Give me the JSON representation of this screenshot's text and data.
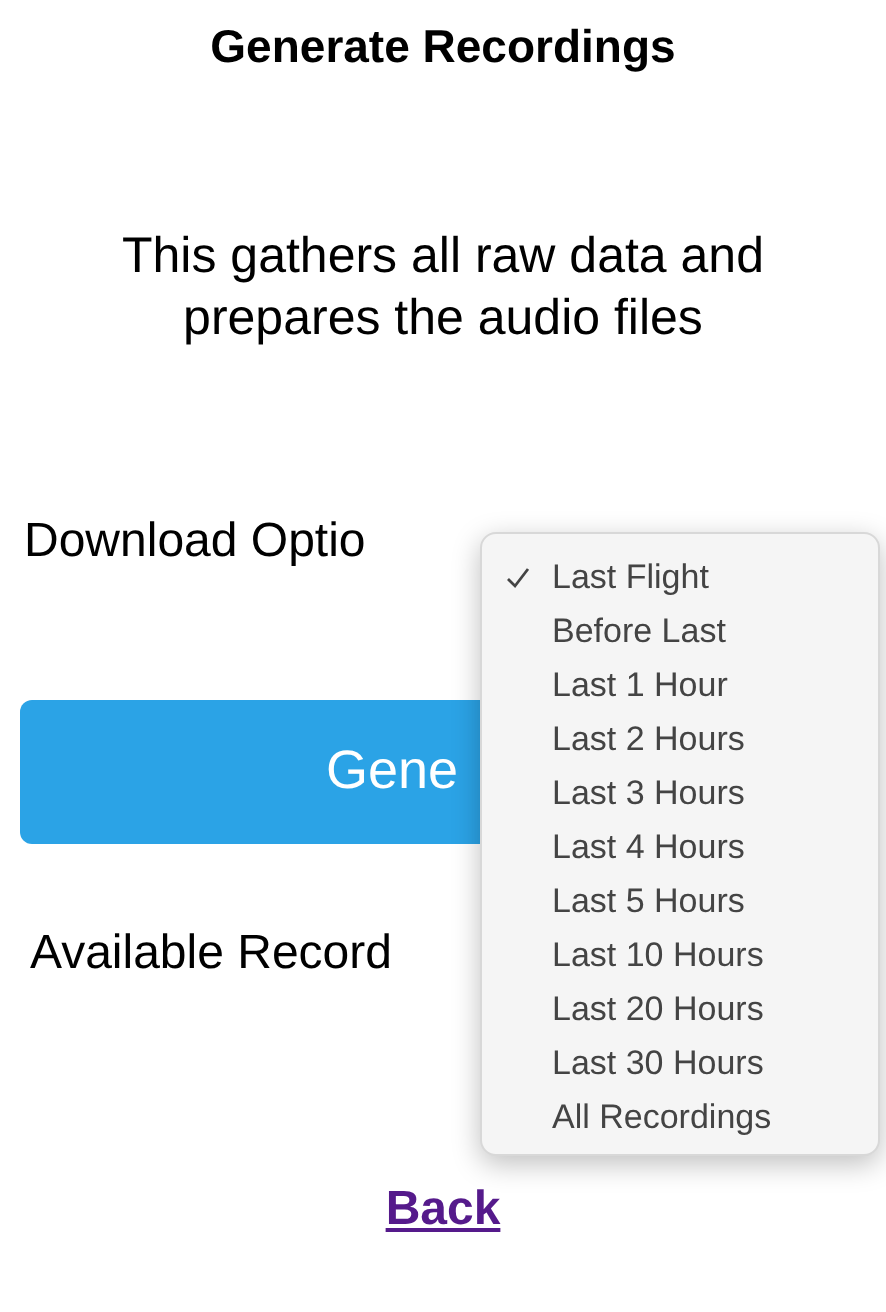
{
  "title": "Generate Recordings",
  "description": "This gathers all raw data and prepares the audio files",
  "download_option": {
    "label": "Download Optio",
    "options": [
      {
        "label": "Last Flight",
        "selected": true
      },
      {
        "label": "Before Last",
        "selected": false
      },
      {
        "label": "Last 1 Hour",
        "selected": false
      },
      {
        "label": "Last 2 Hours",
        "selected": false
      },
      {
        "label": "Last 3 Hours",
        "selected": false
      },
      {
        "label": "Last 4 Hours",
        "selected": false
      },
      {
        "label": "Last 5 Hours",
        "selected": false
      },
      {
        "label": "Last 10 Hours",
        "selected": false
      },
      {
        "label": "Last 20 Hours",
        "selected": false
      },
      {
        "label": "Last 30 Hours",
        "selected": false
      },
      {
        "label": "All Recordings",
        "selected": false
      }
    ]
  },
  "generate_button": "Gene",
  "available_label": "Available Record",
  "back_link": "Back"
}
